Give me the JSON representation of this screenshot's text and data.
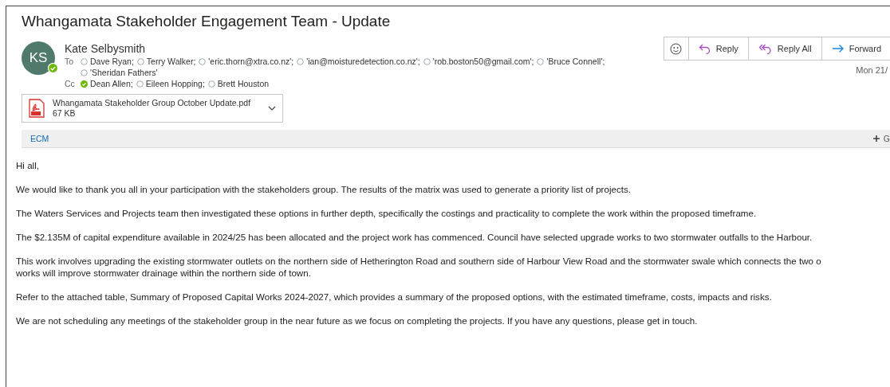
{
  "subject": "Whangamata Stakeholder Engagement Team - Update",
  "sender": {
    "initials": "KS",
    "name": "Kate Selbysmith",
    "online": true
  },
  "to_label": "To",
  "to": [
    {
      "name": "Dave Ryan;",
      "online": false
    },
    {
      "name": "Terry Walker;",
      "online": false
    },
    {
      "name": "'eric.thorn@xtra.co.nz';",
      "online": false
    },
    {
      "name": "'ian@moisturedetection.co.nz';",
      "online": false
    },
    {
      "name": "'rob.boston50@gmail.com';",
      "online": false
    },
    {
      "name": "'Bruce Connell';",
      "online": false
    },
    {
      "name": "'Sheridan Fathers'",
      "online": false
    }
  ],
  "cc_label": "Cc",
  "cc": [
    {
      "name": "Dean Allen;",
      "online": true
    },
    {
      "name": "Eileen Hopping;",
      "online": false
    },
    {
      "name": "Brett Houston",
      "online": false
    }
  ],
  "actions": [
    {
      "label": "Reply",
      "kind": "reply"
    },
    {
      "label": "Reply All",
      "kind": "reply-all"
    },
    {
      "label": "Forward",
      "kind": "forward"
    }
  ],
  "date": "Mon 21/",
  "attachment": {
    "name": "Whangamata Stakeholder Group October Update.pdf",
    "size": "67 KB"
  },
  "addin_bar": {
    "label": "ECM",
    "right": "G"
  },
  "body": [
    [
      "Hi all,"
    ],
    [
      "We would like to thank you all in your participation with the stakeholders group. The results of the matrix was used to generate a priority list of projects."
    ],
    [
      "The Waters Services and Projects team then investigated these options in further depth, specifically the costings and practicality to complete the work within the proposed timeframe."
    ],
    [
      "The $2.135M of capital expenditure available in 2024/25 has been allocated and the project work has commenced. Council have selected upgrade works to two stormwater outfalls to the Harbour."
    ],
    [
      "This work involves upgrading the existing stormwater outlets on the northern side of Hetherington Road and southern side of Harbour View Road and the stormwater swale which connects the two o",
      "works will improve stormwater drainage within the northern side of town."
    ],
    [
      "Refer to the attached table, Summary of Proposed Capital Works 2024-2027, which provides a summary of the proposed options, with the estimated timeframe, costs, impacts and risks."
    ],
    [
      "We are not scheduling any meetings of the stakeholder group in the near future as we focus on completing the projects. If you have any questions, please get in touch."
    ]
  ]
}
